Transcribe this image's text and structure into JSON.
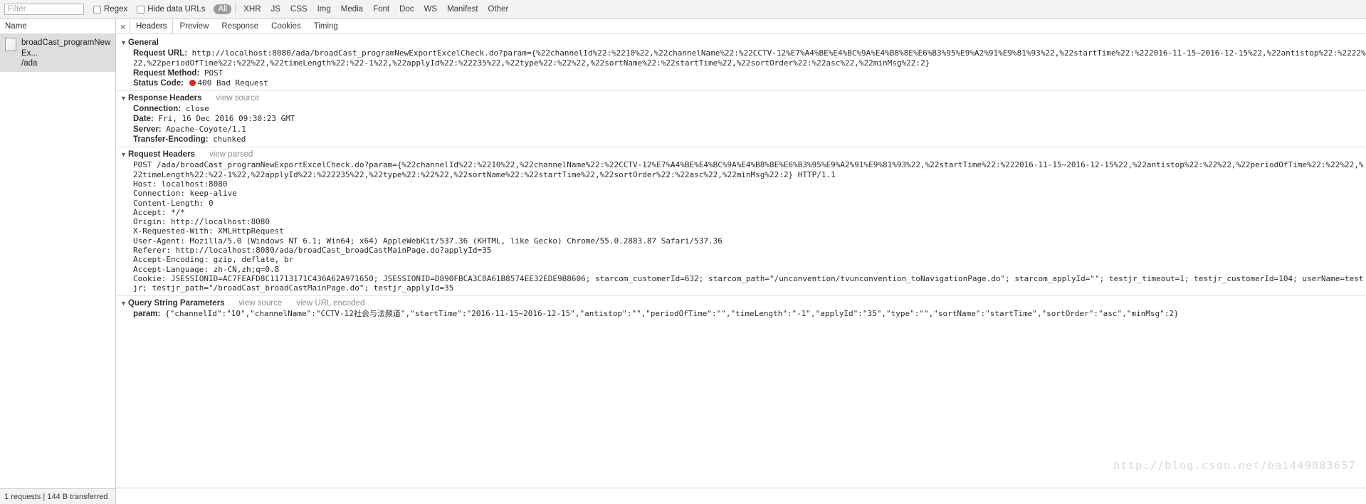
{
  "toolbar": {
    "filter_placeholder": "Filter",
    "regex_label": "Regex",
    "hide_data_urls_label": "Hide data URLs",
    "types": [
      {
        "label": "All",
        "active": true
      },
      {
        "label": "XHR",
        "active": false
      },
      {
        "label": "JS",
        "active": false
      },
      {
        "label": "CSS",
        "active": false
      },
      {
        "label": "Img",
        "active": false
      },
      {
        "label": "Media",
        "active": false
      },
      {
        "label": "Font",
        "active": false
      },
      {
        "label": "Doc",
        "active": false
      },
      {
        "label": "WS",
        "active": false
      },
      {
        "label": "Manifest",
        "active": false
      },
      {
        "label": "Other",
        "active": false
      }
    ]
  },
  "sidebar": {
    "column_header": "Name",
    "request": {
      "name": "broadCast_programNewEx...",
      "path": "/ada"
    },
    "footer": "1 requests | 144 B transferred"
  },
  "tabs": {
    "close_label": "×",
    "items": [
      {
        "label": "Headers",
        "selected": true
      },
      {
        "label": "Preview",
        "selected": false
      },
      {
        "label": "Response",
        "selected": false
      },
      {
        "label": "Cookies",
        "selected": false
      },
      {
        "label": "Timing",
        "selected": false
      }
    ]
  },
  "general": {
    "title": "General",
    "request_url_label": "Request URL:",
    "request_url_value": "http://localhost:8080/ada/broadCast_programNewExportExcelCheck.do?param={%22channelId%22:%2210%22,%22channelName%22:%22CCTV-12%E7%A4%BE%E4%BC%9A%E4%B8%8E%E6%B3%95%E9%A2%91%E9%81%93%22,%22startTime%22:%222016-11-15~2016-12-15%22,%22antistop%22:%2222%22,%22periodOfTime%22:%22%22,%22timeLength%22:%22-1%22,%22applyId%22:%22235%22,%22type%22:%22%22,%22sortName%22:%22startTime%22,%22sortOrder%22:%22asc%22,%22minMsg%22:2}",
    "request_method_label": "Request Method:",
    "request_method_value": "POST",
    "status_code_label": "Status Code:",
    "status_code_value": "400 Bad Request",
    "status_color": "#e02020"
  },
  "response_headers": {
    "title": "Response Headers",
    "link": "view source",
    "rows": [
      {
        "name": "Connection:",
        "value": "close"
      },
      {
        "name": "Date:",
        "value": "Fri, 16 Dec 2016 09:30:23 GMT"
      },
      {
        "name": "Server:",
        "value": "Apache-Coyote/1.1"
      },
      {
        "name": "Transfer-Encoding:",
        "value": "chunked"
      }
    ]
  },
  "request_headers": {
    "title": "Request Headers",
    "link": "view parsed",
    "raw_request_line": "POST /ada/broadCast_programNewExportExcelCheck.do?param={%22channelId%22:%2210%22,%22channelName%22:%22CCTV-12%E7%A4%BE%E4%BC%9A%E4%B8%8E%E6%B3%95%E9%A2%91%E9%81%93%22,%22startTime%22:%222016-11-15~2016-12-15%22,%22antistop%22:%22%22,%22periodOfTime%22:%22%22,%22timeLength%22:%22-1%22,%22applyId%22:%222235%22,%22type%22:%22%22,%22sortName%22:%22startTime%22,%22sortOrder%22:%22asc%22,%22minMsg%22:2} HTTP/1.1",
    "raw_lines": [
      "Host: localhost:8080",
      "Connection: keep-alive",
      "Content-Length: 0",
      "Accept: */*",
      "Origin: http://localhost:8080",
      "X-Requested-With: XMLHttpRequest",
      "User-Agent: Mozilla/5.0 (Windows NT 6.1; Win64; x64) AppleWebKit/537.36 (KHTML, like Gecko) Chrome/55.0.2883.87 Safari/537.36",
      "Referer: http://localhost:8080/ada/broadCast_broadCastMainPage.do?applyId=35",
      "Accept-Encoding: gzip, deflate, br",
      "Accept-Language: zh-CN,zh;q=0.8",
      "Cookie: JSESSIONID=AC7FEAFD8C11713171C436A62A971650; JSESSIONID=D890FBCA3C8A61B8574EE32EDE9B8606; starcom_customerId=632; starcom_path=\"/unconvention/tvunconvention_toNavigationPage.do\"; starcom_applyId=\"\"; testjr_timeout=1; testjr_customerId=104; userName=testjr; testjr_path=\"/broadCast_broadCastMainPage.do\"; testjr_applyId=35"
    ]
  },
  "query_string": {
    "title": "Query String Parameters",
    "link_source": "view source",
    "link_encoded": "view URL encoded",
    "param_label": "param:",
    "param_value": "{\"channelId\":\"10\",\"channelName\":\"CCTV-12社会与法频道\",\"startTime\":\"2016-11-15~2016-12-15\",\"antistop\":\"\",\"periodOfTime\":\"\",\"timeLength\":\"-1\",\"applyId\":\"35\",\"type\":\"\",\"sortName\":\"startTime\",\"sortOrder\":\"asc\",\"minMsg\":2}"
  },
  "watermark": "http://blog.csdn.net/bai449083657"
}
